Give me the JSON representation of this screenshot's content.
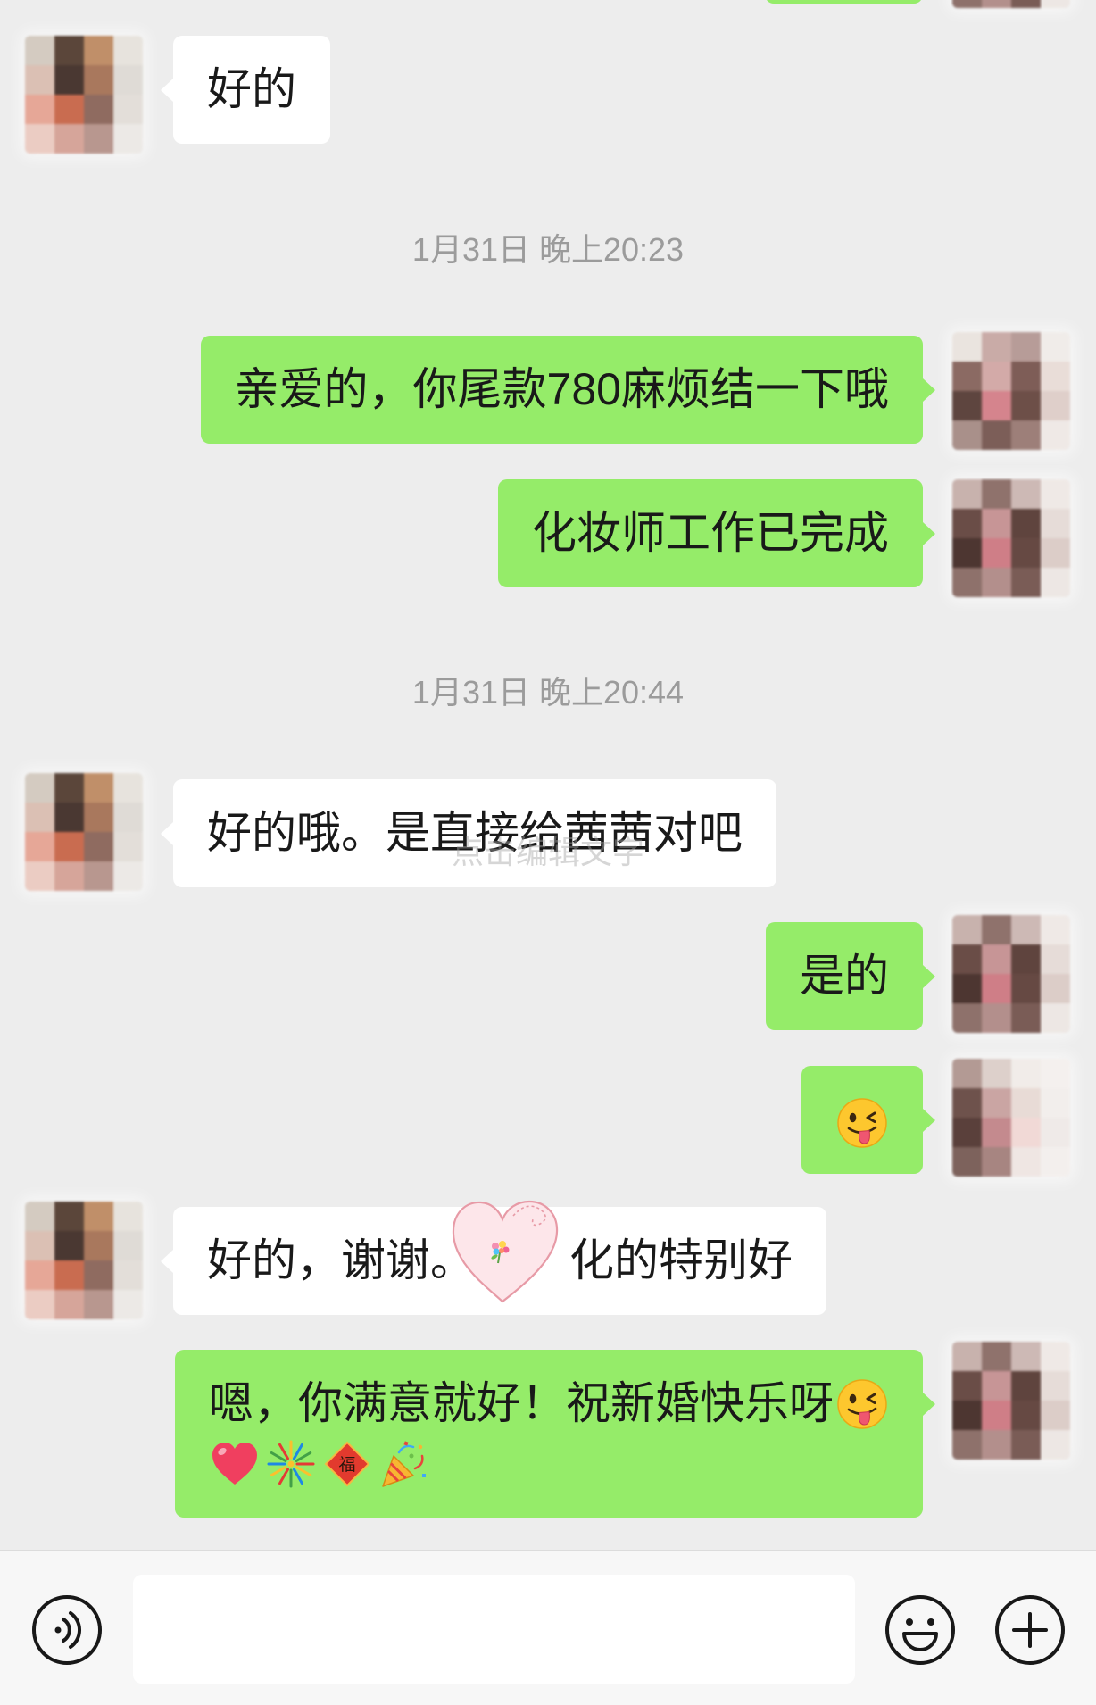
{
  "colors": {
    "page_background": "#ededed",
    "my_bubble": "#95ec69",
    "their_bubble": "#ffffff",
    "timestamp_text": "#9b9b9b",
    "input_bar": "#f7f7f7"
  },
  "chat": {
    "timestamps": [
      "1月31日 晚上20:23",
      "1月31日 晚上20:44"
    ],
    "watermark": "点击编辑文字",
    "messages": [
      {
        "from_me": false,
        "text": "好的"
      },
      {
        "from_me": true,
        "text": "亲爱的，你尾款780麻烦结一下哦"
      },
      {
        "from_me": true,
        "text": "化妆师工作已完成"
      },
      {
        "from_me": false,
        "text": "好的哦。是直接给茜茜对吧"
      },
      {
        "from_me": true,
        "text": "是的"
      },
      {
        "from_me": true,
        "emoji": [
          "winking-face-with-tongue-emoji"
        ]
      },
      {
        "from_me": false,
        "text_before_sticker": "好的，谢谢。",
        "text_after_sticker": "化的特别好",
        "sticker": "heart-bouquet-sticker"
      },
      {
        "from_me": true,
        "text": "嗯，你满意就好！祝新婚快乐呀",
        "emoji": [
          "winking-face-with-tongue-emoji",
          "red-heart-emoji",
          "fireworks-emoji",
          "fu-diamond-emoji",
          "party-popper-emoji"
        ],
        "fu_char": "福"
      }
    ]
  },
  "input_bar": {
    "value": "",
    "icons": {
      "voice": "voice-input-icon",
      "emoji": "emoji-icon",
      "more": "plus-icon"
    }
  }
}
